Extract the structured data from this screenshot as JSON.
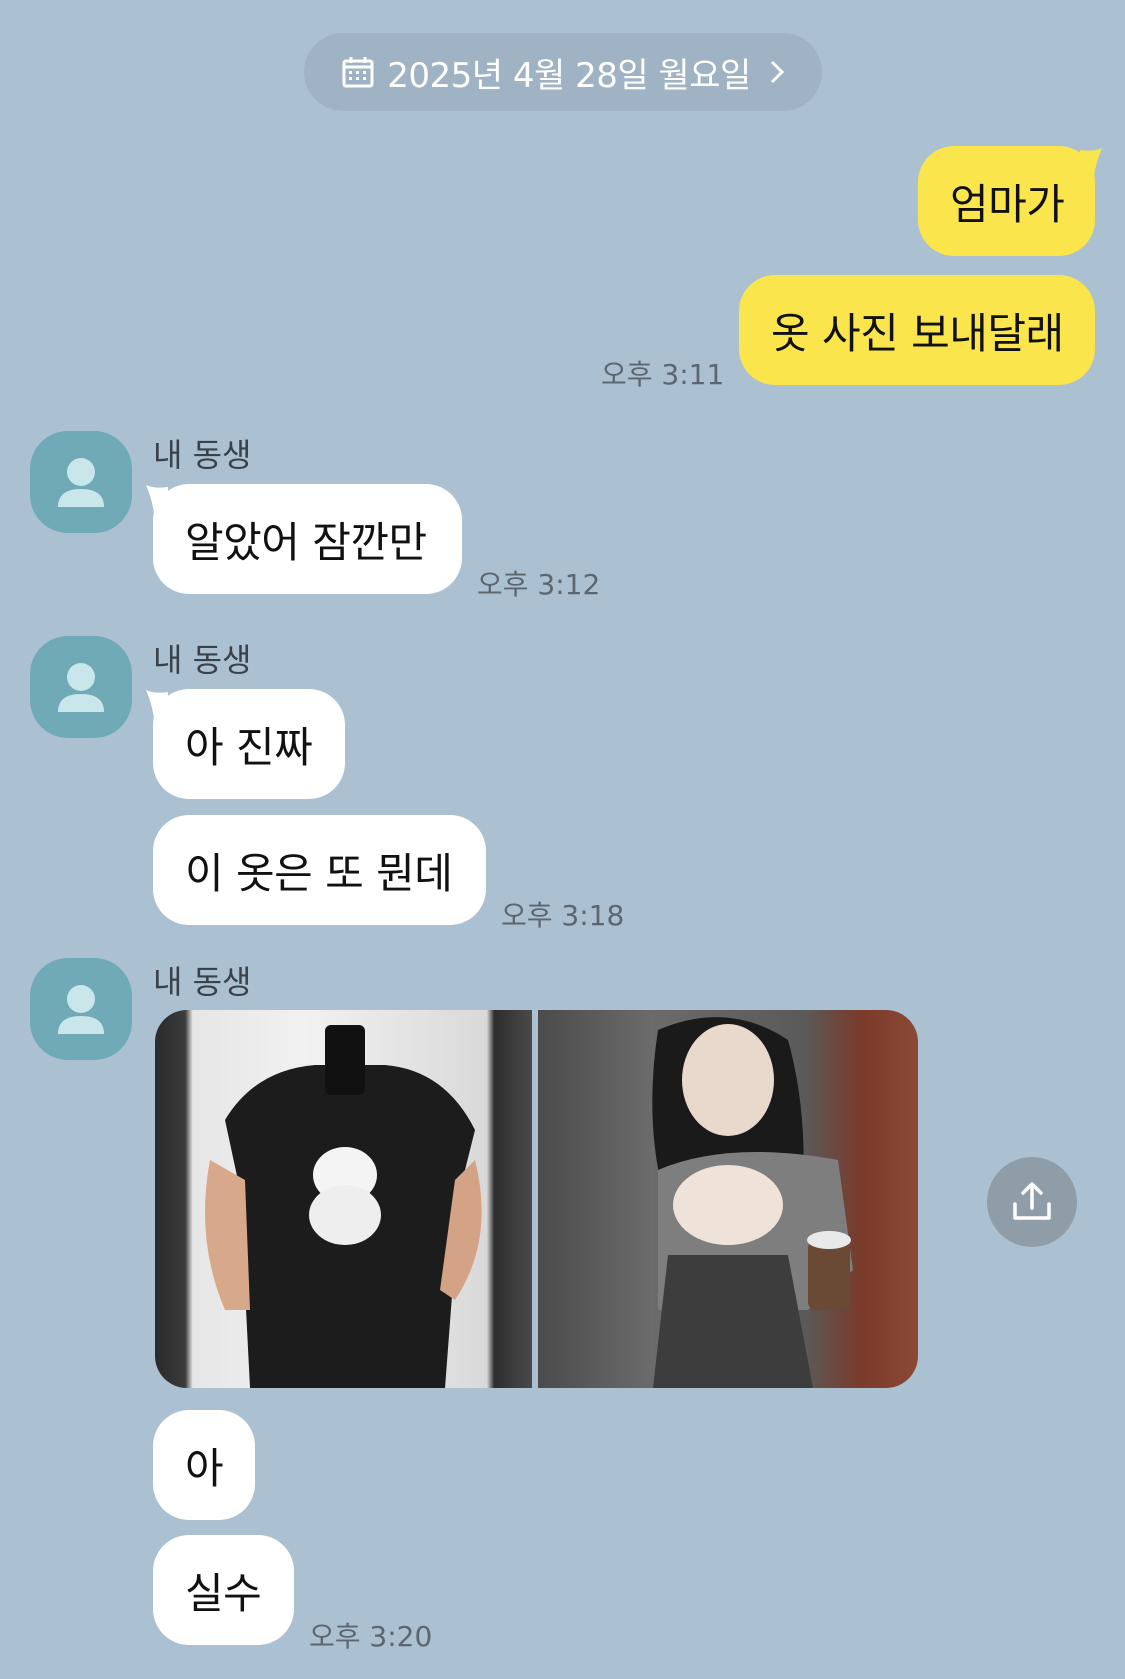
{
  "date_header": {
    "label": "2025년 4월 28일 월요일"
  },
  "messages": {
    "me_1": "엄마가",
    "me_2": "옷 사진 보내달래",
    "me_time": "오후 3:11",
    "group1_sender": "내 동생",
    "group1_msg": "알았어 잠깐만",
    "group1_time": "오후 3:12",
    "group2_sender": "내 동생",
    "group2_msg1": "아 진짜",
    "group2_msg2": "이 옷은 또 뭔데",
    "group2_time": "오후 3:18",
    "group3_sender": "내 동생",
    "group3_msg1": "아",
    "group3_msg2": "실수",
    "group3_time": "오후 3:20"
  },
  "icons": {
    "calendar": "calendar-icon",
    "chevron": "chevron-right-icon",
    "avatar": "person-icon",
    "share": "upload-share-icon"
  },
  "colors": {
    "background": "#abc1d1",
    "my_bubble": "#fbe54d",
    "their_bubble": "#ffffff",
    "avatar": "#6faab6"
  }
}
